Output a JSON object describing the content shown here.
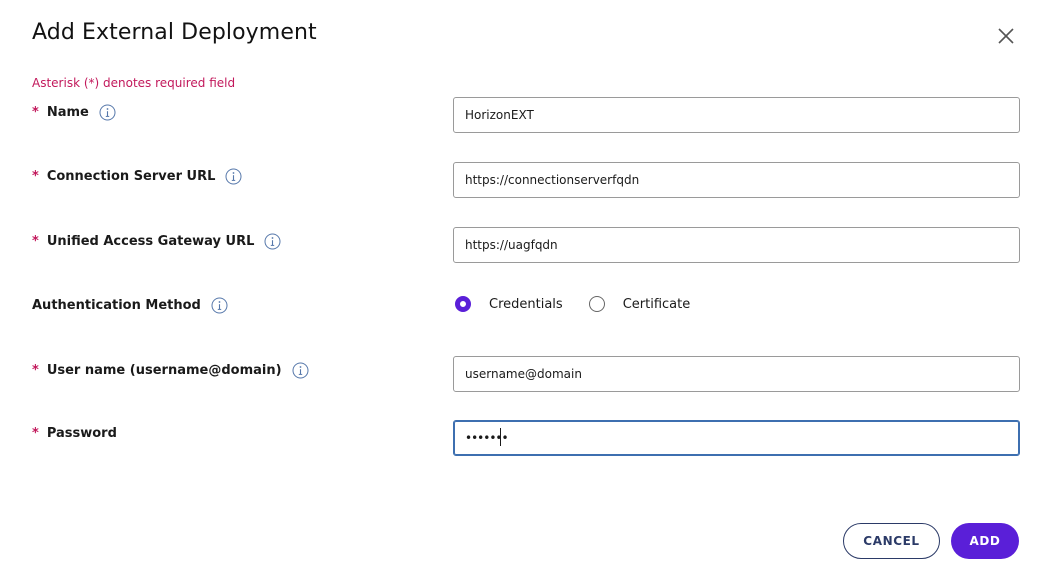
{
  "dialog": {
    "title": "Add External Deployment",
    "required_note": "Asterisk (*) denotes required field"
  },
  "fields": {
    "name": {
      "asterisk": "*",
      "label": "Name",
      "value": "HorizonEXT"
    },
    "connection_server_url": {
      "asterisk": "*",
      "label": "Connection Server URL",
      "value": "https://connectionserverfqdn"
    },
    "uag_url": {
      "asterisk": "*",
      "label": "Unified Access Gateway URL",
      "value": "https://uagfqdn"
    },
    "auth_method": {
      "label": "Authentication Method",
      "options": [
        {
          "label": "Credentials",
          "selected": true
        },
        {
          "label": "Certificate",
          "selected": false
        }
      ]
    },
    "username": {
      "asterisk": "*",
      "label": "User name (username@domain)",
      "value": "username@domain"
    },
    "password": {
      "asterisk": "*",
      "label": "Password",
      "value": "•••••••"
    }
  },
  "actions": {
    "cancel_label": "CANCEL",
    "add_label": "ADD"
  },
  "colors": {
    "accent": "#5a1fd8",
    "required": "#c2185b",
    "cancel_border": "#2b3a67",
    "focus_border": "#3d6fb0"
  },
  "icons": {
    "close": "close-icon",
    "info": "info-icon"
  }
}
